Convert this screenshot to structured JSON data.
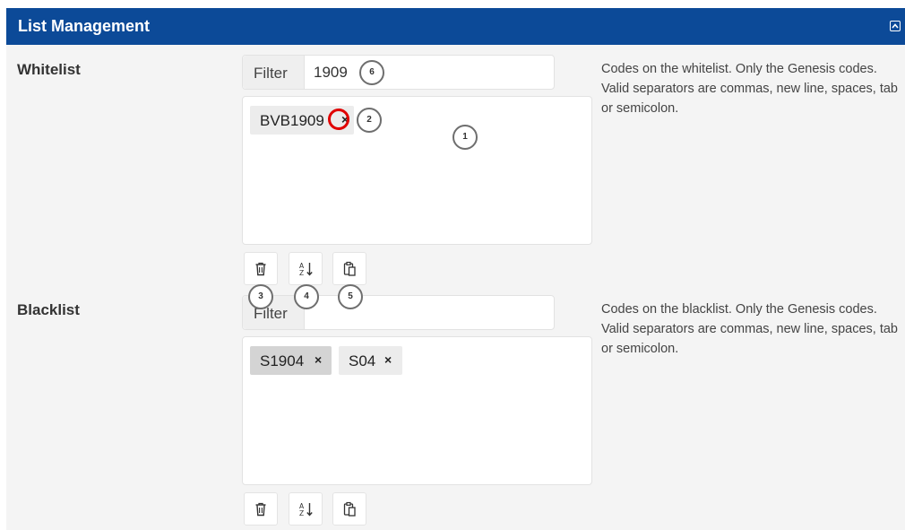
{
  "panel": {
    "title": "List Management",
    "collapse_icon": "collapse-up-icon"
  },
  "whitelist": {
    "label": "Whitelist",
    "filter_label": "Filter",
    "filter_value": "1909",
    "tags": [
      {
        "text": "BVB1909",
        "remove": "×"
      }
    ],
    "help": "Codes on the whitelist. Only the Genesis codes. Valid separators are commas, new line, spaces, tab or semicolon.",
    "tools": [
      "trash-icon",
      "sort-az-icon",
      "paste-icon"
    ]
  },
  "blacklist": {
    "label": "Blacklist",
    "filter_label": "Filter",
    "filter_value": "",
    "tags": [
      {
        "text": "S1904",
        "remove": "×"
      },
      {
        "text": "S04",
        "remove": "×"
      }
    ],
    "help": "Codes on the blacklist. Only the Genesis codes. Valid separators are commas, new line, spaces, tab or semicolon.",
    "tools": [
      "trash-icon",
      "sort-az-icon",
      "paste-icon"
    ]
  },
  "callouts": [
    "1",
    "2",
    "3",
    "4",
    "5",
    "6"
  ],
  "highlight_color": "#e00000",
  "header_color": "#0c4a98"
}
